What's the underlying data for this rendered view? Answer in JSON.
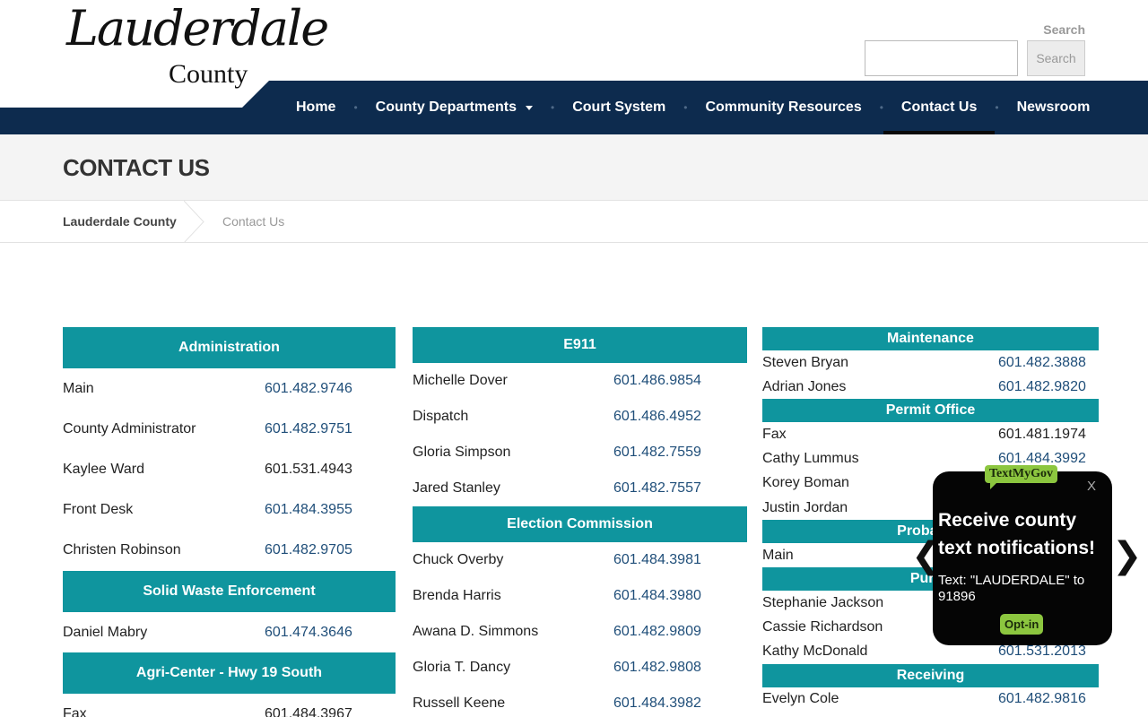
{
  "logo": {
    "script_text": "Lauderdale",
    "sub_text": "County"
  },
  "search": {
    "label": "Search",
    "button_label": "Search",
    "placeholder": ""
  },
  "nav": {
    "items": [
      {
        "label": "Home"
      },
      {
        "label": "County Departments"
      },
      {
        "label": "Court System"
      },
      {
        "label": "Community Resources"
      },
      {
        "label": "Contact Us"
      },
      {
        "label": "Newsroom"
      }
    ]
  },
  "page_title": "CONTACT US",
  "breadcrumb": {
    "home": "Lauderdale County",
    "current": "Contact Us"
  },
  "directory": {
    "col1": {
      "administration": {
        "title": "Administration",
        "rows": [
          {
            "name": "Main",
            "phone": "601.482.9746"
          },
          {
            "name": "County Administrator",
            "phone": "601.482.9751"
          },
          {
            "name": "Kaylee Ward",
            "phone": "601.531.4943"
          },
          {
            "name": "Front Desk",
            "phone": "601.484.3955"
          },
          {
            "name": "Christen Robinson",
            "phone": "601.482.9705"
          }
        ]
      },
      "solid_waste": {
        "title": "Solid Waste Enforcement",
        "rows": [
          {
            "name": "Daniel Mabry",
            "phone": "601.474.3646"
          }
        ]
      },
      "agri_center": {
        "title": "Agri-Center - Hwy 19 South",
        "rows": [
          {
            "name": "Fax",
            "phone": "601.484.3967"
          }
        ]
      }
    },
    "col2": {
      "e911": {
        "title": "E911",
        "rows": [
          {
            "name": "Michelle Dover",
            "phone": "601.486.9854"
          },
          {
            "name": "Dispatch",
            "phone": "601.486.4952"
          },
          {
            "name": "Gloria Simpson",
            "phone": "601.482.7559"
          },
          {
            "name": "Jared Stanley",
            "phone": "601.482.7557"
          }
        ]
      },
      "election": {
        "title": "Election Commission",
        "rows": [
          {
            "name": "Chuck Overby",
            "phone": "601.484.3981"
          },
          {
            "name": "Brenda Harris",
            "phone": "601.484.3980"
          },
          {
            "name": "Awana D. Simmons",
            "phone": "601.482.9809"
          },
          {
            "name": "Gloria T. Dancy",
            "phone": "601.482.9808"
          },
          {
            "name": "Russell Keene",
            "phone": "601.484.3982"
          }
        ]
      }
    },
    "col3": {
      "maintenance": {
        "title": "Maintenance",
        "rows": [
          {
            "name": "Steven Bryan",
            "phone": "601.482.3888"
          },
          {
            "name": "Adrian Jones",
            "phone": "601.482.9820"
          }
        ]
      },
      "permit": {
        "title": "Permit Office",
        "rows": [
          {
            "name": "Fax",
            "phone": "601.481.1974"
          },
          {
            "name": "Cathy Lummus",
            "phone": "601.484.3992"
          },
          {
            "name": "Korey Boman",
            "phone": ""
          },
          {
            "name": "Justin Jordan",
            "phone": ""
          }
        ]
      },
      "probation": {
        "title": "Probation",
        "rows": [
          {
            "name": "Main",
            "phone": ""
          }
        ]
      },
      "purchasing": {
        "title": "Purch",
        "rows": [
          {
            "name": "Stephanie Jackson",
            "phone": ""
          },
          {
            "name": "Cassie Richardson",
            "phone": ""
          },
          {
            "name": "Kathy McDonald",
            "phone": "601.531.2013"
          }
        ]
      },
      "receiving": {
        "title": "Receiving",
        "rows": [
          {
            "name": "Evelyn Cole",
            "phone": "601.482.9816"
          }
        ]
      }
    }
  },
  "popup": {
    "tag": "TextMyGov",
    "close": "X",
    "heading": "Receive county text notifications!",
    "text": "Text: \"LAUDERDALE\" to 91896",
    "optin": "Opt-in",
    "prev": "❮",
    "next": "❯"
  },
  "colors": {
    "nav": "#0d2b4e",
    "section": "#0f959e",
    "phone_link": "#1f4e79",
    "popup_green": "#8cc63f"
  }
}
